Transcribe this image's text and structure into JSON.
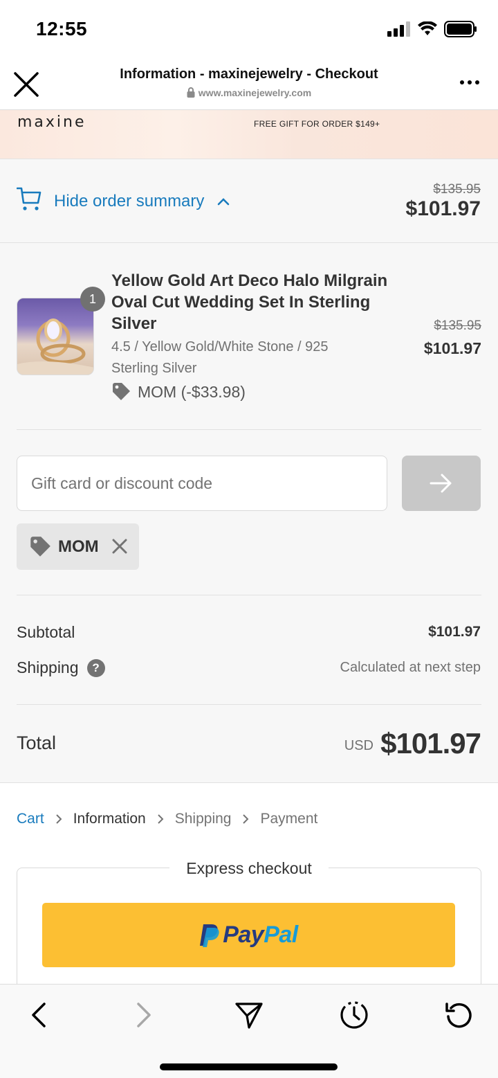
{
  "status_bar": {
    "time": "12:55"
  },
  "browser": {
    "title": "Information - maxinejewelry - Checkout",
    "url": "www.maxinejewelry.com"
  },
  "banner": {
    "brand": "maxine",
    "promo": "FREE GIFT FOR ORDER $149+"
  },
  "summary": {
    "toggle_label": "Hide order summary",
    "original_price": "$135.95",
    "price": "$101.97"
  },
  "product": {
    "quantity": "1",
    "name": "Yellow Gold Art Deco Halo Milgrain Oval Cut Wedding Set In Sterling Silver",
    "variant": "4.5 / Yellow Gold/White Stone / 925 Sterling Silver",
    "discount": "MOM (-$33.98)",
    "original_price": "$135.95",
    "price": "$101.97"
  },
  "discount_form": {
    "placeholder": "Gift card or discount code",
    "applied_code": "MOM"
  },
  "totals": {
    "subtotal_label": "Subtotal",
    "subtotal_value": "$101.97",
    "shipping_label": "Shipping",
    "shipping_help": "?",
    "shipping_value": "Calculated at next step",
    "total_label": "Total",
    "currency": "USD",
    "total_value": "$101.97"
  },
  "breadcrumb": {
    "cart": "Cart",
    "information": "Information",
    "shipping": "Shipping",
    "payment": "Payment"
  },
  "express": {
    "title": "Express checkout",
    "paypal_pay": "Pay",
    "paypal_pal": "Pal"
  },
  "colors": {
    "link": "#197bbd",
    "paypal_button": "#fcbf33",
    "apply_button_disabled": "#c8c8c8"
  },
  "icons": {
    "close": "close-icon",
    "more": "more-icon",
    "cart": "cart-icon",
    "tag": "tag-icon",
    "arrow": "arrow-right-icon",
    "remove": "close-icon",
    "help": "help-icon",
    "back": "chevron-left-icon",
    "forward": "chevron-right-icon",
    "share": "send-icon",
    "history": "history-icon",
    "reload": "reload-icon"
  }
}
